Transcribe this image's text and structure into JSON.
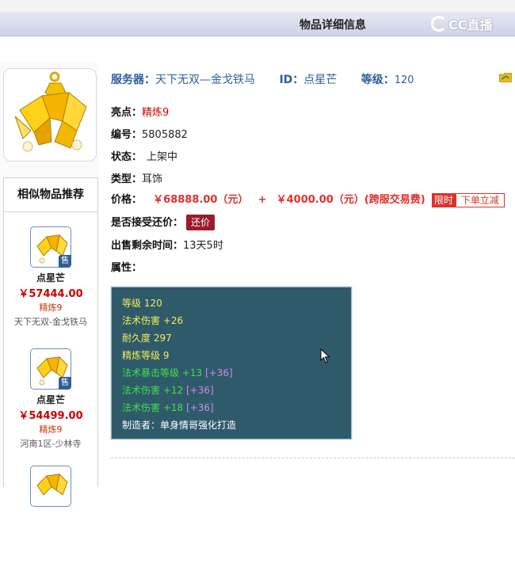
{
  "header": {
    "title": "物品详细信息",
    "logo_text": "CC直播"
  },
  "item": {
    "server_label": "服务器：",
    "server": "天下无双—金戈铁马",
    "id_label": "ID：",
    "id": "点星芒",
    "level_label": "等级：",
    "level": "120",
    "highlight_label": "亮点：",
    "highlight": "精炼9",
    "number_label": "编号：",
    "number": "5805882",
    "status_label": "状态：",
    "status": "上架中",
    "type_label": "类型：",
    "type": "耳饰",
    "price_label": "价格：",
    "price": "￥68888.00（元）",
    "plus": "+",
    "fee": "￥4000.00（元）(跨服交易费)",
    "limit_tag": "限时",
    "buy_now": "下单立减",
    "bargain_label": "是否接受还价：",
    "bargain_button": "还价",
    "time_label": "出售剩余时间：",
    "time_left": "13天5时",
    "attr_label": "属性："
  },
  "attributes": [
    {
      "name": "等级",
      "value": "120",
      "extra": "",
      "color": "#f4ef55"
    },
    {
      "name": "法术伤害",
      "value": "+26",
      "extra": "",
      "color": "#f4ef55"
    },
    {
      "name": "耐久度",
      "value": "297",
      "extra": "",
      "color": "#f4ef55"
    },
    {
      "name": "精炼等级",
      "value": "9",
      "extra": "",
      "color": "#f4ef55"
    },
    {
      "name": "法术暴击等级",
      "value": "+13",
      "extra": "[+36]",
      "color": "#41e04a"
    },
    {
      "name": "法术伤害",
      "value": "+12",
      "extra": "[+36]",
      "color": "#41e04a"
    },
    {
      "name": "法术伤害",
      "value": "+18",
      "extra": "[+36]",
      "color": "#41e04a"
    }
  ],
  "maker": "制造者：单身情哥强化打造",
  "recommend": {
    "title": "相似物品推荐",
    "sold_tag": "售",
    "items": [
      {
        "name": "点星芒",
        "price": "￥57444.00",
        "highlight": "精炼9",
        "server": "天下无双-金戈铁马"
      },
      {
        "name": "点星芒",
        "price": "￥54499.00",
        "highlight": "精炼9",
        "server": "河南1区-少林寺"
      }
    ]
  }
}
